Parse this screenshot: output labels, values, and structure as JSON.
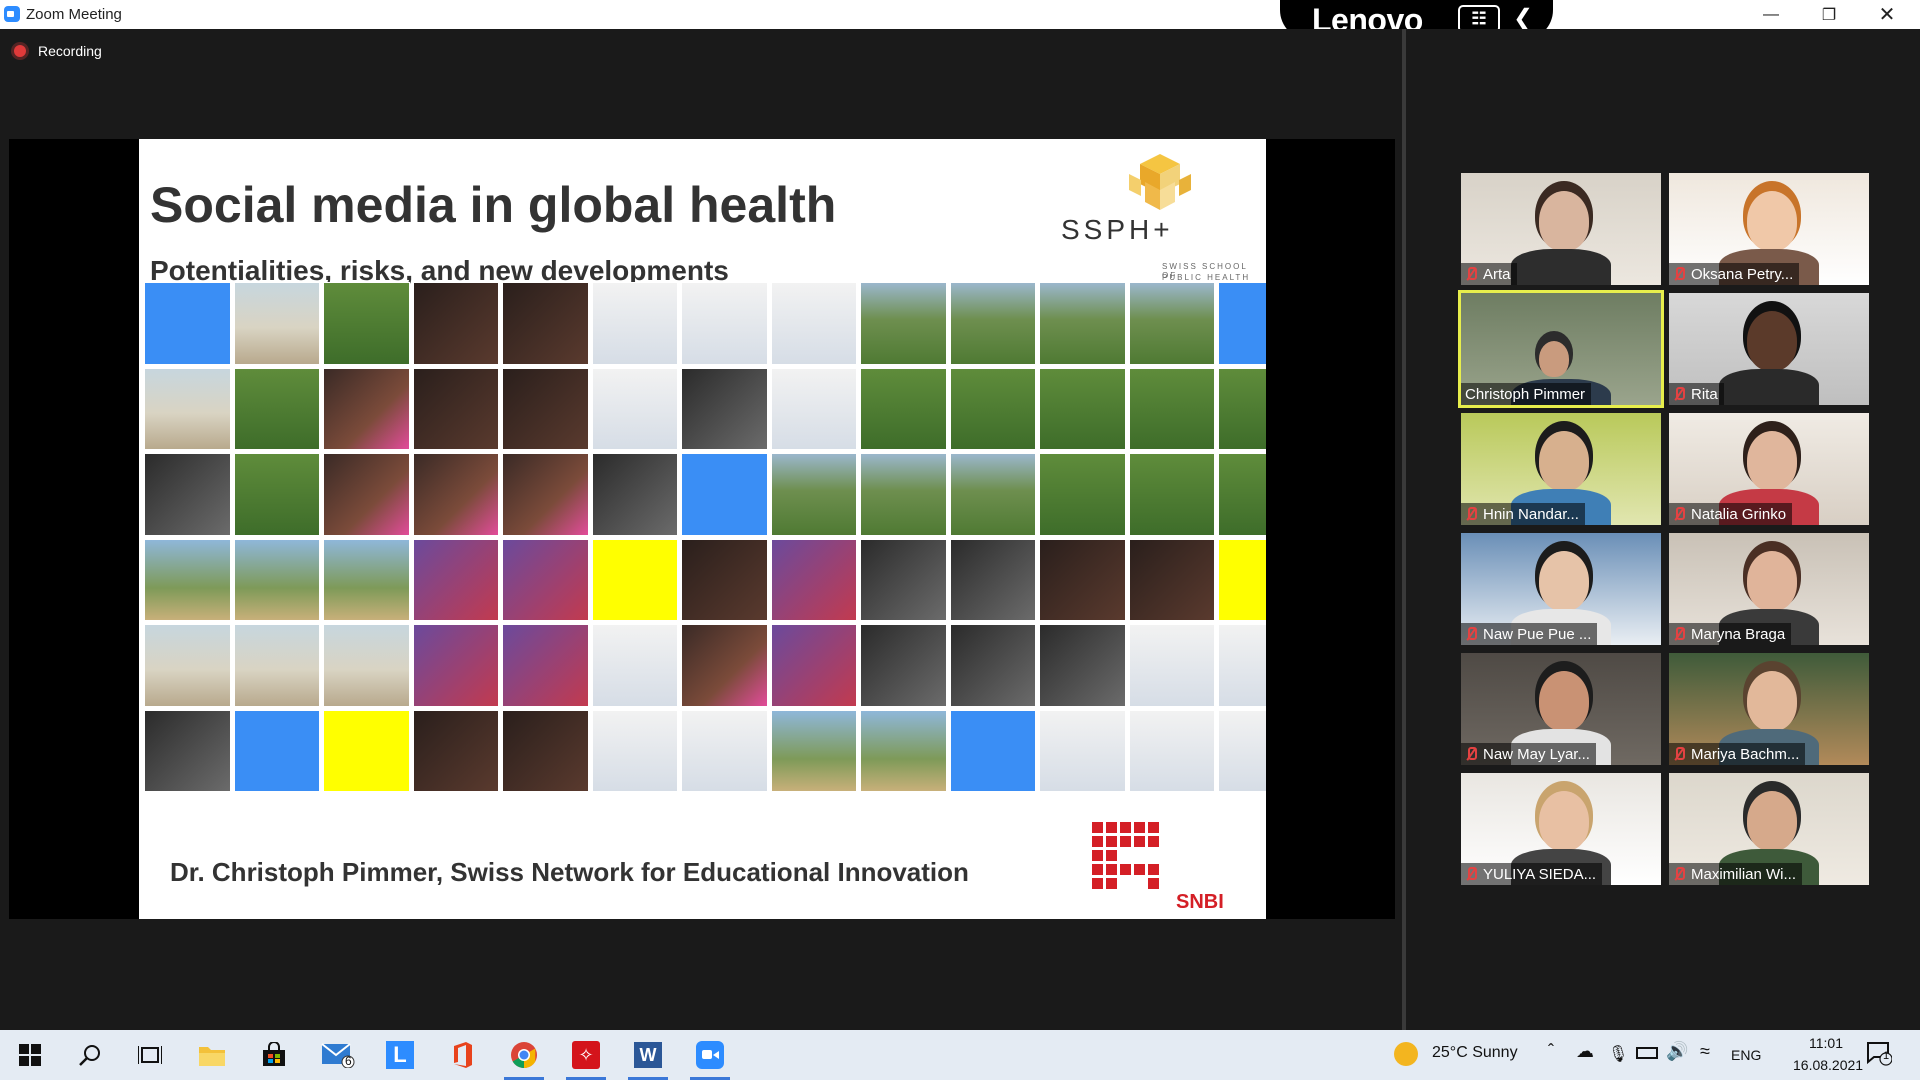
{
  "window": {
    "title": "Zoom Meeting"
  },
  "vendor_badge": {
    "brand": "Lenovo"
  },
  "meeting": {
    "recording_label": "Recording"
  },
  "slide": {
    "title": "Social media in global health",
    "subtitle": "Potentialities, risks, and new developments",
    "author_line": "Dr. Christoph Pimmer, Swiss Network for Educational Innovation",
    "logo_ssph": {
      "name": "SSPH+",
      "line1": "SWISS SCHOOL OF",
      "line2": "PUBLIC HEALTH"
    },
    "logo_snbi": {
      "name": "SNBI"
    }
  },
  "participants": [
    {
      "name": "Arta",
      "muted": true,
      "active": false
    },
    {
      "name": "Oksana Petry...",
      "muted": true,
      "active": false
    },
    {
      "name": "Christoph Pimmer",
      "muted": false,
      "active": true
    },
    {
      "name": "Rita",
      "muted": true,
      "active": false
    },
    {
      "name": "Hnin Nandar...",
      "muted": true,
      "active": false
    },
    {
      "name": "Natalia Grinko",
      "muted": true,
      "active": false
    },
    {
      "name": "Naw Pue Pue ...",
      "muted": true,
      "active": false
    },
    {
      "name": "Maryna Braga",
      "muted": true,
      "active": false
    },
    {
      "name": "Naw May Lyar...",
      "muted": true,
      "active": false
    },
    {
      "name": "Mariya Bachm...",
      "muted": true,
      "active": false
    },
    {
      "name": "YULIYA SIEDA...",
      "muted": true,
      "active": false
    },
    {
      "name": "Maximilian Wi...",
      "muted": true,
      "active": false
    }
  ],
  "taskbar": {
    "mail_badge": "6",
    "weather": "25°C  Sunny",
    "language": "ENG",
    "time": "11:01",
    "date": "16.08.2021",
    "notification_count": "1",
    "apps": [
      "start",
      "search",
      "task-view",
      "file-explorer",
      "store",
      "mail",
      "lenovo-vantage",
      "office",
      "chrome",
      "acrobat",
      "word",
      "zoom"
    ]
  },
  "colors": {
    "accent_blue": "#3a8ef5",
    "accent_yellow": "#ffff00",
    "snbi_red": "#d41f26",
    "active_speaker": "#e7ee4c"
  }
}
